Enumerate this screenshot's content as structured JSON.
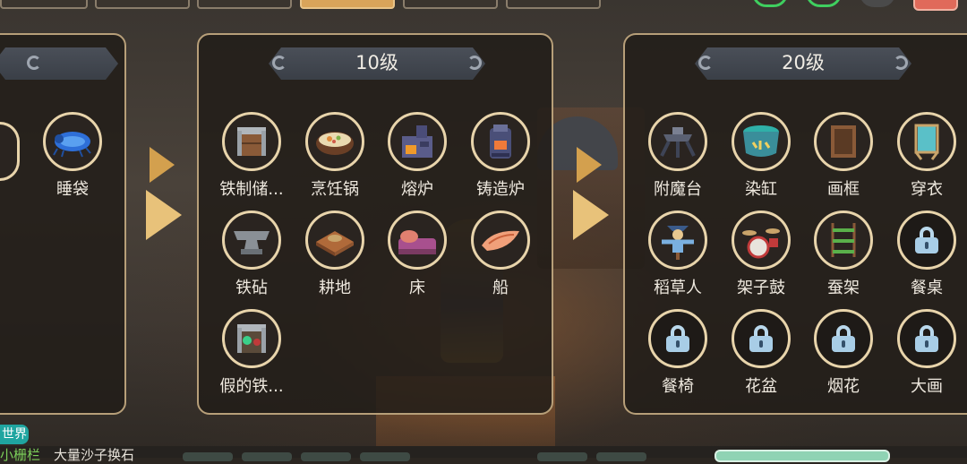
{
  "panels": {
    "left": {
      "items": [
        {
          "label": "睡袋",
          "icon": "sleeping-bag-icon"
        }
      ]
    },
    "level10": {
      "title": "10级",
      "items": [
        {
          "label": "铁制储...",
          "icon": "iron-storage-icon"
        },
        {
          "label": "烹饪锅",
          "icon": "cooking-pot-icon"
        },
        {
          "label": "熔炉",
          "icon": "furnace-icon"
        },
        {
          "label": "铸造炉",
          "icon": "foundry-icon"
        },
        {
          "label": "铁砧",
          "icon": "anvil-icon"
        },
        {
          "label": "耕地",
          "icon": "farmland-icon"
        },
        {
          "label": "床",
          "icon": "bed-icon"
        },
        {
          "label": "船",
          "icon": "boat-icon"
        },
        {
          "label": "假的铁...",
          "icon": "fake-iron-chest-icon"
        }
      ]
    },
    "level20": {
      "title": "20级",
      "items": [
        {
          "label": "附魔台",
          "icon": "enchanting-table-icon",
          "locked": false
        },
        {
          "label": "染缸",
          "icon": "dye-vat-icon",
          "locked": false
        },
        {
          "label": "画框",
          "icon": "picture-frame-icon",
          "locked": false
        },
        {
          "label": "穿衣",
          "icon": "dressing-mirror-icon",
          "locked": false
        },
        {
          "label": "稻草人",
          "icon": "scarecrow-icon",
          "locked": false
        },
        {
          "label": "架子鼓",
          "icon": "drum-kit-icon",
          "locked": false
        },
        {
          "label": "蚕架",
          "icon": "silkworm-rack-icon",
          "locked": false
        },
        {
          "label": "餐桌",
          "icon": "lock-icon",
          "locked": true
        },
        {
          "label": "餐椅",
          "icon": "lock-icon",
          "locked": true
        },
        {
          "label": "花盆",
          "icon": "lock-icon",
          "locked": true
        },
        {
          "label": "烟花",
          "icon": "lock-icon",
          "locked": true
        },
        {
          "label": "大画",
          "icon": "lock-icon",
          "locked": true
        }
      ]
    }
  },
  "chat": {
    "channel": "世界",
    "sender": "小栅栏",
    "message": "大量沙子换石"
  },
  "colors": {
    "panel_border": "#b79f79",
    "item_ring": "#e8d4ab",
    "arrow": "#e8c27a",
    "active_tab": "#d9a45a",
    "chat_badge": "#1fa5a0"
  }
}
